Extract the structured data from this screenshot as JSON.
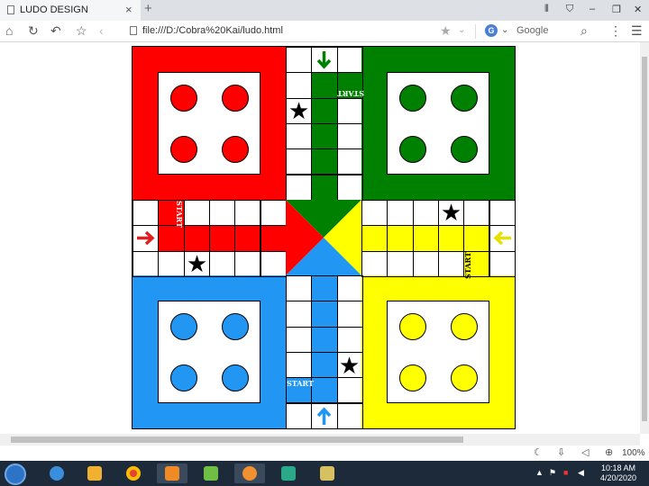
{
  "browser": {
    "tab_title": "LUDO DESIGN",
    "tab_close": "×",
    "new_tab": "+",
    "url": "file:///D:/Cobra%20Kai/ludo.html",
    "search_placeholder": "Google",
    "search_engine_badge": "G",
    "zoom": "100%"
  },
  "board": {
    "start_label": "START",
    "home_colors": {
      "red": "#ff0000",
      "green": "#008000",
      "blue": "#2196f3",
      "yellow": "#ffff00"
    }
  },
  "taskbar": {
    "time": "10:18 AM",
    "date": "4/20/2020"
  }
}
